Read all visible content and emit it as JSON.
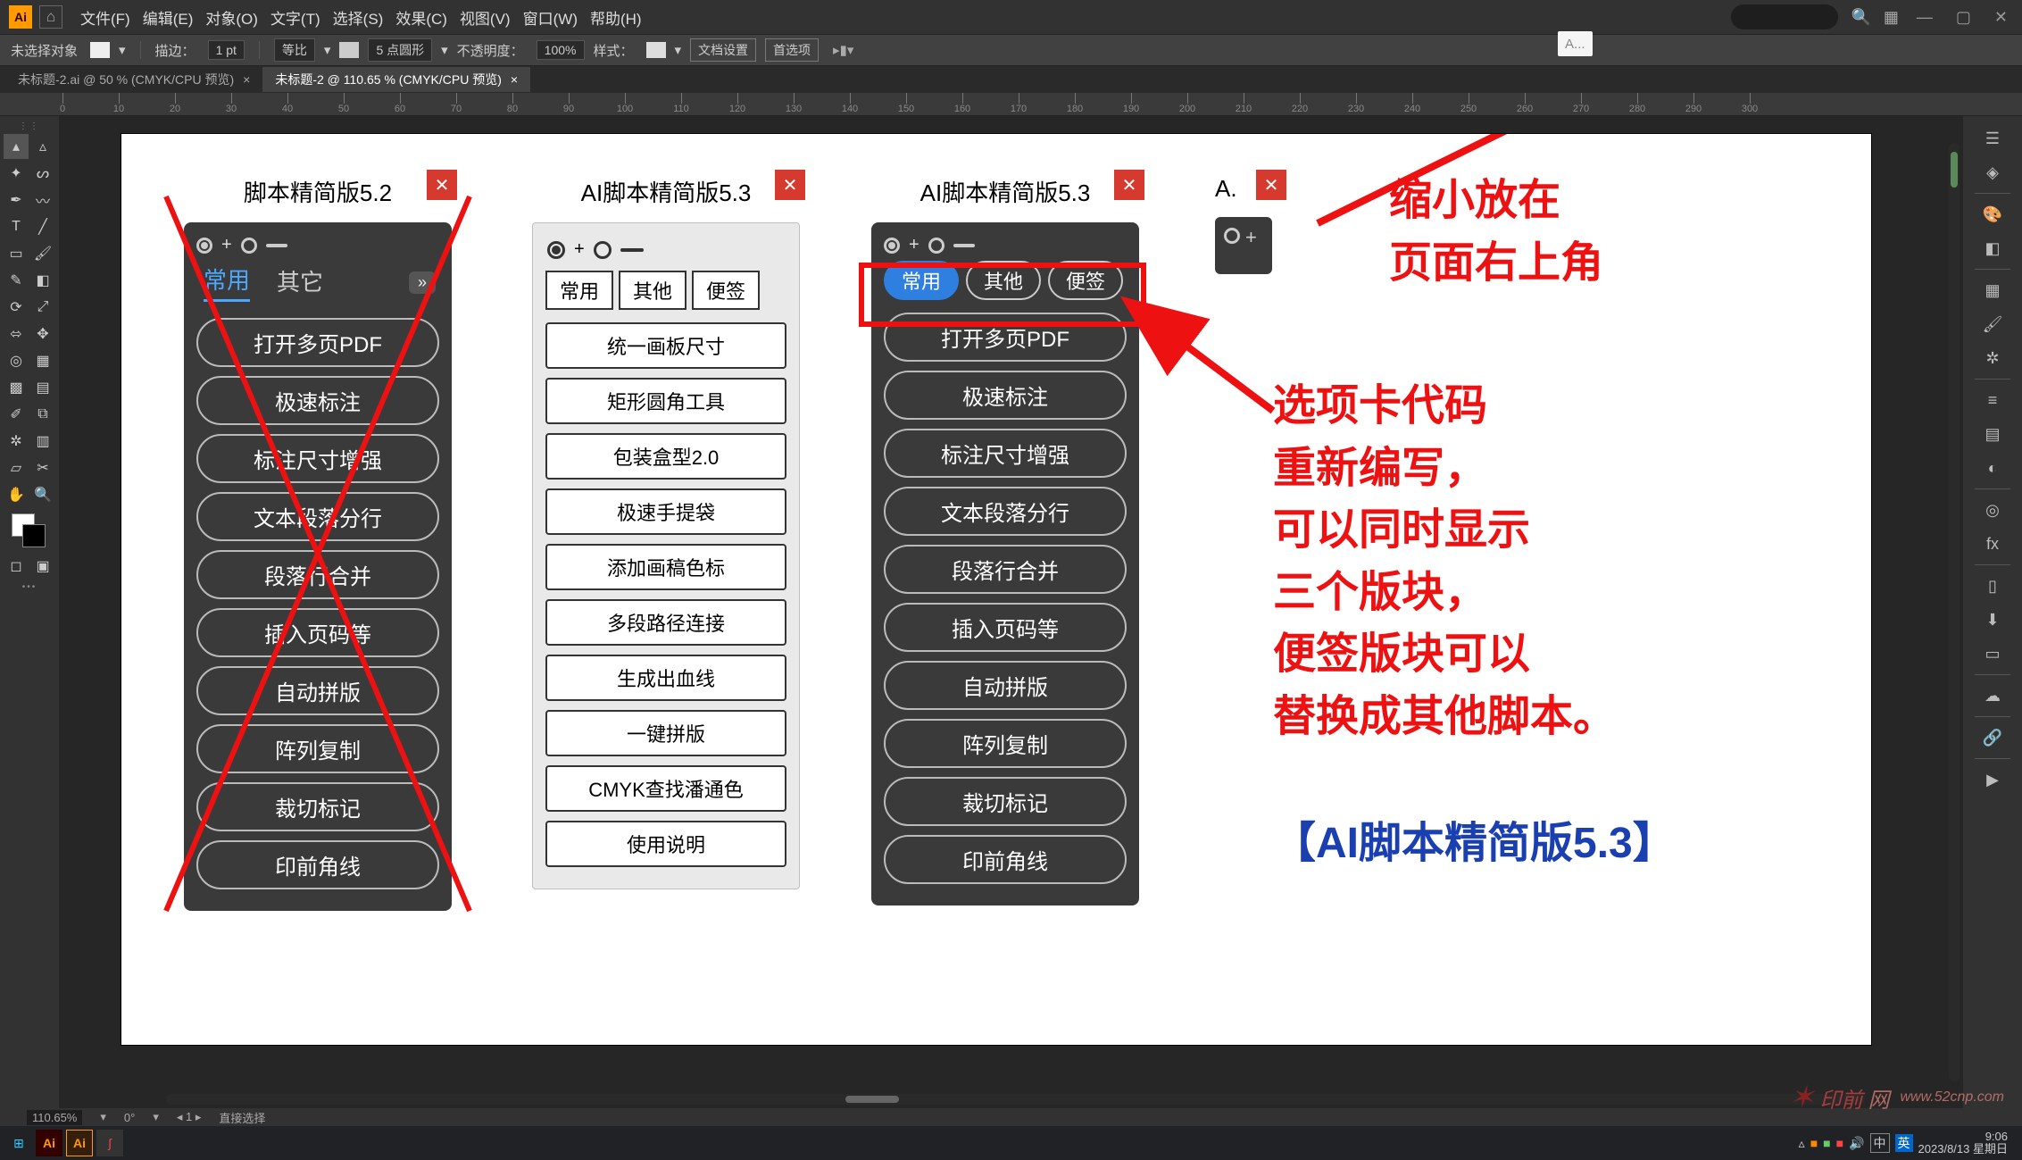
{
  "app": {
    "logo": "Ai",
    "title_search_hint": "A..."
  },
  "menu": [
    "文件(F)",
    "编辑(E)",
    "对象(O)",
    "文字(T)",
    "选择(S)",
    "效果(C)",
    "视图(V)",
    "窗口(W)",
    "帮助(H)"
  ],
  "control": {
    "noSel": "未选择对象",
    "stroke": "描边：",
    "stroke_val": "1 pt",
    "uniform": "等比",
    "dot": "5 点圆形",
    "opacity": "不透明度：",
    "opacity_val": "100%",
    "style": "样式：",
    "docSetup": "文档设置",
    "prefs": "首选项"
  },
  "docTabs": [
    {
      "label": "未标题-2.ai @ 50 % (CMYK/CPU 预览)",
      "active": false
    },
    {
      "label": "未标题-2 @ 110.65 % (CMYK/CPU 预览)",
      "active": true
    }
  ],
  "status": {
    "zoom": "110.65%",
    "rot": "0°",
    "art": "1",
    "tool": "直接选择"
  },
  "panel1": {
    "title": "脚本精简版5.2",
    "tabs": {
      "a": "常用",
      "b": "其它"
    },
    "buttons": [
      "打开多页PDF",
      "极速标注",
      "标注尺寸增强",
      "文本段落分行",
      "段落行合并",
      "插入页码等",
      "自动拼版",
      "阵列复制",
      "裁切标记",
      "印前角线"
    ]
  },
  "panel2": {
    "title": "AI脚本精简版5.3",
    "tabs": [
      "常用",
      "其他",
      "便签"
    ],
    "buttons": [
      "统一画板尺寸",
      "矩形圆角工具",
      "包装盒型2.0",
      "极速手提袋",
      "添加画稿色标",
      "多段路径连接",
      "生成出血线",
      "一键拼版",
      "CMYK查找潘通色",
      "使用说明"
    ]
  },
  "panel3": {
    "title": "AI脚本精简版5.3",
    "tabs": [
      "常用",
      "其他",
      "便签"
    ],
    "buttons": [
      "打开多页PDF",
      "极速标注",
      "标注尺寸增强",
      "文本段落分行",
      "段落行合并",
      "插入页码等",
      "自动拼版",
      "阵列复制",
      "裁切标记",
      "印前角线"
    ]
  },
  "panel4": {
    "title": "A."
  },
  "annot": {
    "a1": "缩小放在\n页面右上角",
    "a2": "选项卡代码\n重新编写，\n可以同时显示\n三个版块，\n便签版块可以\n替换成其他脚本。",
    "a3": "【AI脚本精简版5.3】"
  },
  "taskbar": {
    "time": "9:06",
    "date": "2023/8/13 星期日",
    "watermark": "www.52cnp.com"
  }
}
